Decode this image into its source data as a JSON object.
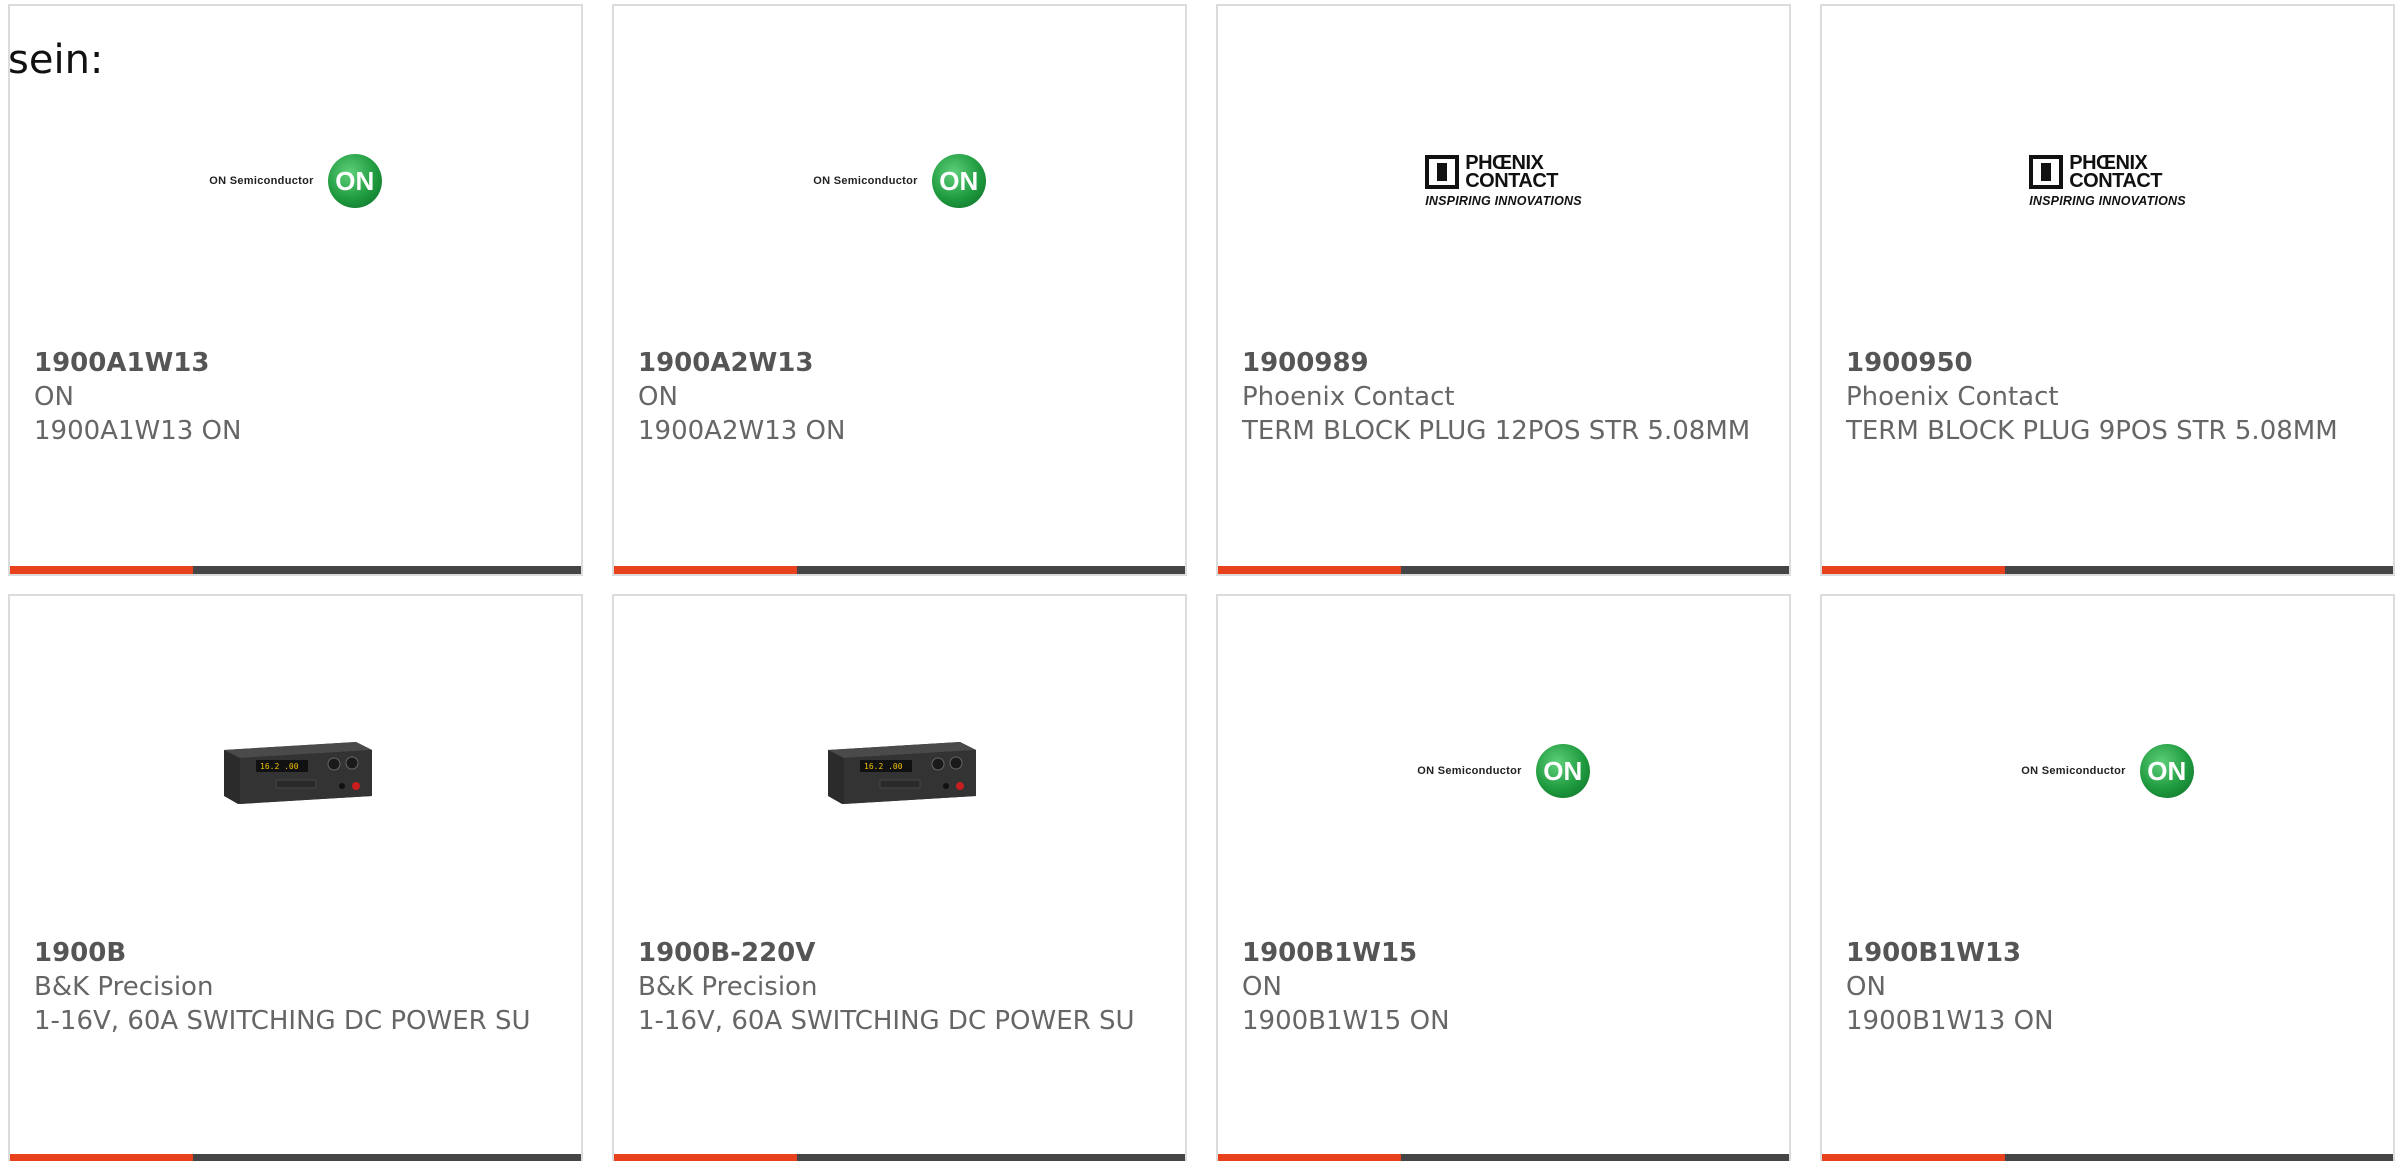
{
  "page": {
    "partial_text": "sein:"
  },
  "products": [
    {
      "part_number": "1900A1W13",
      "manufacturer": "ON",
      "description": "1900A1W13 ON",
      "logo": "on-semiconductor-logo",
      "logo_text": "ON Semiconductor",
      "logo_badge": "ON"
    },
    {
      "part_number": "1900A2W13",
      "manufacturer": "ON",
      "description": "1900A2W13 ON",
      "logo": "on-semiconductor-logo",
      "logo_text": "ON Semiconductor",
      "logo_badge": "ON"
    },
    {
      "part_number": "1900989",
      "manufacturer": "Phoenix Contact",
      "description": "TERM BLOCK PLUG 12POS STR 5.08MM",
      "logo": "phoenix-contact-logo",
      "logo_line1": "PHŒNIX",
      "logo_line2": "CONTACT",
      "logo_tagline": "INSPIRING INNOVATIONS"
    },
    {
      "part_number": "1900950",
      "manufacturer": "Phoenix Contact",
      "description": "TERM BLOCK PLUG 9POS STR 5.08MM",
      "logo": "phoenix-contact-logo",
      "logo_line1": "PHŒNIX",
      "logo_line2": "CONTACT",
      "logo_tagline": "INSPIRING INNOVATIONS"
    },
    {
      "part_number": "1900B",
      "manufacturer": "B&K Precision",
      "description": "1-16V, 60A SWITCHING DC POWER SU",
      "logo": "power-supply-image",
      "display_text": "16.2 .00"
    },
    {
      "part_number": "1900B-220V",
      "manufacturer": "B&K Precision",
      "description": "1-16V, 60A SWITCHING DC POWER SU",
      "logo": "power-supply-image",
      "display_text": "16.2 .00"
    },
    {
      "part_number": "1900B1W15",
      "manufacturer": "ON",
      "description": "1900B1W15 ON",
      "logo": "on-semiconductor-logo",
      "logo_text": "ON Semiconductor",
      "logo_badge": "ON"
    },
    {
      "part_number": "1900B1W13",
      "manufacturer": "ON",
      "description": "1900B1W13 ON",
      "logo": "on-semiconductor-logo",
      "logo_text": "ON Semiconductor",
      "logo_badge": "ON"
    }
  ],
  "colors": {
    "accent": "#e8411d",
    "bar": "#454545",
    "border": "#dcdcdc",
    "text": "#666666",
    "on_green": "#1f9a3f"
  }
}
